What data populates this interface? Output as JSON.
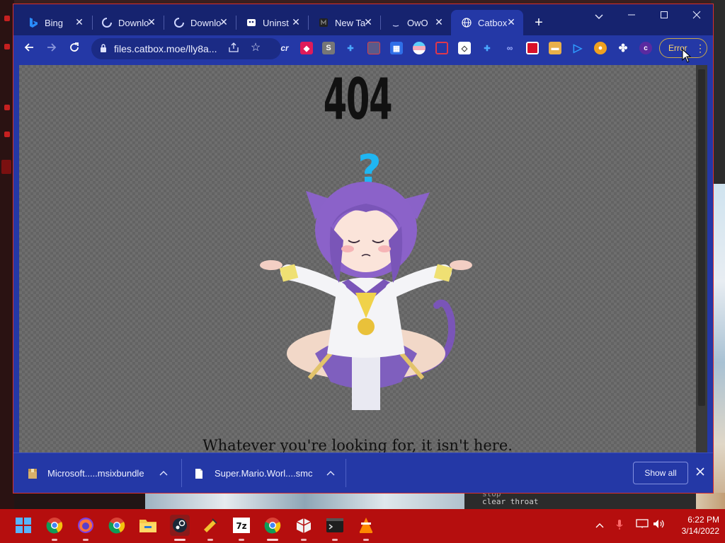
{
  "browser": {
    "tabs": [
      {
        "label": "Bing",
        "icon": "bing-icon"
      },
      {
        "label": "Downlo",
        "icon": "loading-spinner-icon"
      },
      {
        "label": "Downlo",
        "icon": "loading-spinner-icon"
      },
      {
        "label": "Uninst",
        "icon": "app-icon"
      },
      {
        "label": "New Ta",
        "icon": "github-icon"
      },
      {
        "label": "OwO",
        "icon": "owo-icon"
      },
      {
        "label": "Catbox",
        "icon": "globe-icon",
        "active": true
      }
    ],
    "address_bar": {
      "url": "files.catbox.moe/lly8a..."
    },
    "profile_status": "Error",
    "extensions": [
      "cr",
      "puzzle",
      "S",
      "puzzle",
      "box",
      "grid",
      "trans",
      "square",
      "diamond",
      "puzzle",
      "link",
      "rect",
      "folder",
      "play",
      "monkey",
      "extensions",
      "C"
    ]
  },
  "page": {
    "error_code": "404",
    "message": "Whatever you're looking for, it isn't here."
  },
  "downloads": {
    "items": [
      {
        "name": "Microsoft.....msixbundle",
        "icon": "package-icon"
      },
      {
        "name": "Super.Mario.Worl....smc",
        "icon": "file-icon"
      }
    ],
    "show_all_label": "Show all"
  },
  "background": {
    "terminal_lines": [
      "stop",
      "clear throat"
    ]
  },
  "taskbar": {
    "apps": [
      "start",
      "chrome",
      "firefox",
      "chrome",
      "file-explorer",
      "steam",
      "tool",
      "7zip",
      "chrome",
      "package",
      "terminal",
      "vlc"
    ],
    "time": "6:22 PM",
    "date": "3/14/2022"
  },
  "colors": {
    "tabbar_bg": "#16236f",
    "toolbar_bg": "#2438a6",
    "taskbar_bg": "#b50e0e",
    "page_bg": "#6e6e6e",
    "error_accent": "#ffd76a"
  }
}
